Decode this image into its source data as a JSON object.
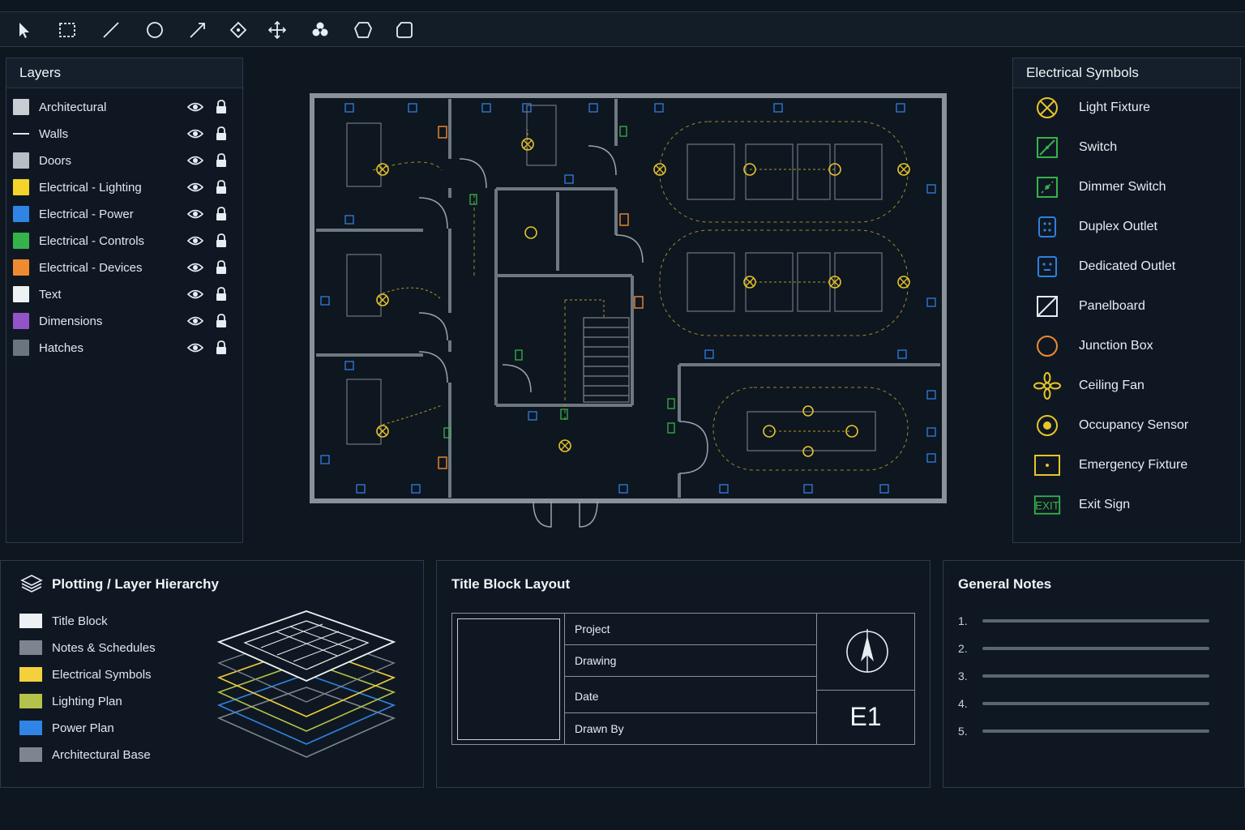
{
  "toolbar": {
    "tools": [
      "select-tool",
      "rectangle-tool",
      "line-tool",
      "circle-tool",
      "arrow-tool",
      "node-tool",
      "move-tool",
      "fan-tool",
      "polygon-tool",
      "rounded-shape-tool"
    ]
  },
  "layers": {
    "title": "Layers",
    "items": [
      {
        "label": "Architectural",
        "color": "#c9ced4",
        "kind": "swatch"
      },
      {
        "label": "Walls",
        "color": "#e0e6ec",
        "kind": "line"
      },
      {
        "label": "Doors",
        "color": "#b8bec6",
        "kind": "swatch"
      },
      {
        "label": "Electrical - Lighting",
        "color": "#f4d32a",
        "kind": "swatch"
      },
      {
        "label": "Electrical - Power",
        "color": "#2f84e6",
        "kind": "swatch"
      },
      {
        "label": "Electrical - Controls",
        "color": "#35b34a",
        "kind": "swatch"
      },
      {
        "label": "Electrical - Devices",
        "color": "#f08a30",
        "kind": "swatch"
      },
      {
        "label": "Text",
        "color": "#eef1f4",
        "kind": "swatch"
      },
      {
        "label": "Dimensions",
        "color": "#9254c8",
        "kind": "swatch"
      },
      {
        "label": "Hatches",
        "color": "#6b7580",
        "kind": "swatch"
      }
    ]
  },
  "symbols": {
    "title": "Electrical Symbols",
    "items": [
      {
        "label": "Light Fixture",
        "icon": "light-fixture-icon"
      },
      {
        "label": "Switch",
        "icon": "switch-icon"
      },
      {
        "label": "Dimmer Switch",
        "icon": "dimmer-switch-icon"
      },
      {
        "label": "Duplex Outlet",
        "icon": "duplex-outlet-icon"
      },
      {
        "label": "Dedicated Outlet",
        "icon": "dedicated-outlet-icon"
      },
      {
        "label": "Panelboard",
        "icon": "panelboard-icon"
      },
      {
        "label": "Junction Box",
        "icon": "junction-box-icon"
      },
      {
        "label": "Ceiling Fan",
        "icon": "ceiling-fan-icon"
      },
      {
        "label": "Occupancy Sensor",
        "icon": "occupancy-sensor-icon"
      },
      {
        "label": "Emergency Fixture",
        "icon": "emergency-fixture-icon"
      },
      {
        "label": "Exit Sign",
        "icon": "exit-sign-icon",
        "icon_text": "EXIT"
      }
    ]
  },
  "plotting": {
    "title": "Plotting / Layer Hierarchy",
    "items": [
      {
        "label": "Title Block",
        "color": "#eef1f4"
      },
      {
        "label": "Notes & Schedules",
        "color": "#7d868f"
      },
      {
        "label": "Electrical Symbols",
        "color": "#f4d03c"
      },
      {
        "label": "Lighting Plan",
        "color": "#b3c24a"
      },
      {
        "label": "Power Plan",
        "color": "#2f84e6"
      },
      {
        "label": "Architectural Base",
        "color": "#7d868f"
      }
    ]
  },
  "title_block": {
    "title": "Title Block Layout",
    "project": "Project",
    "drawing": "Drawing",
    "date": "Date",
    "drawn_by": "Drawn By",
    "sheet": "E1"
  },
  "notes": {
    "title": "General Notes",
    "items": [
      "1.",
      "2.",
      "3.",
      "4.",
      "5."
    ]
  },
  "colors": {
    "lighting": "#e8c52a",
    "power": "#2f7fe0",
    "controls": "#35b34a",
    "devices": "#f08a30",
    "walls": "#8c949d"
  }
}
